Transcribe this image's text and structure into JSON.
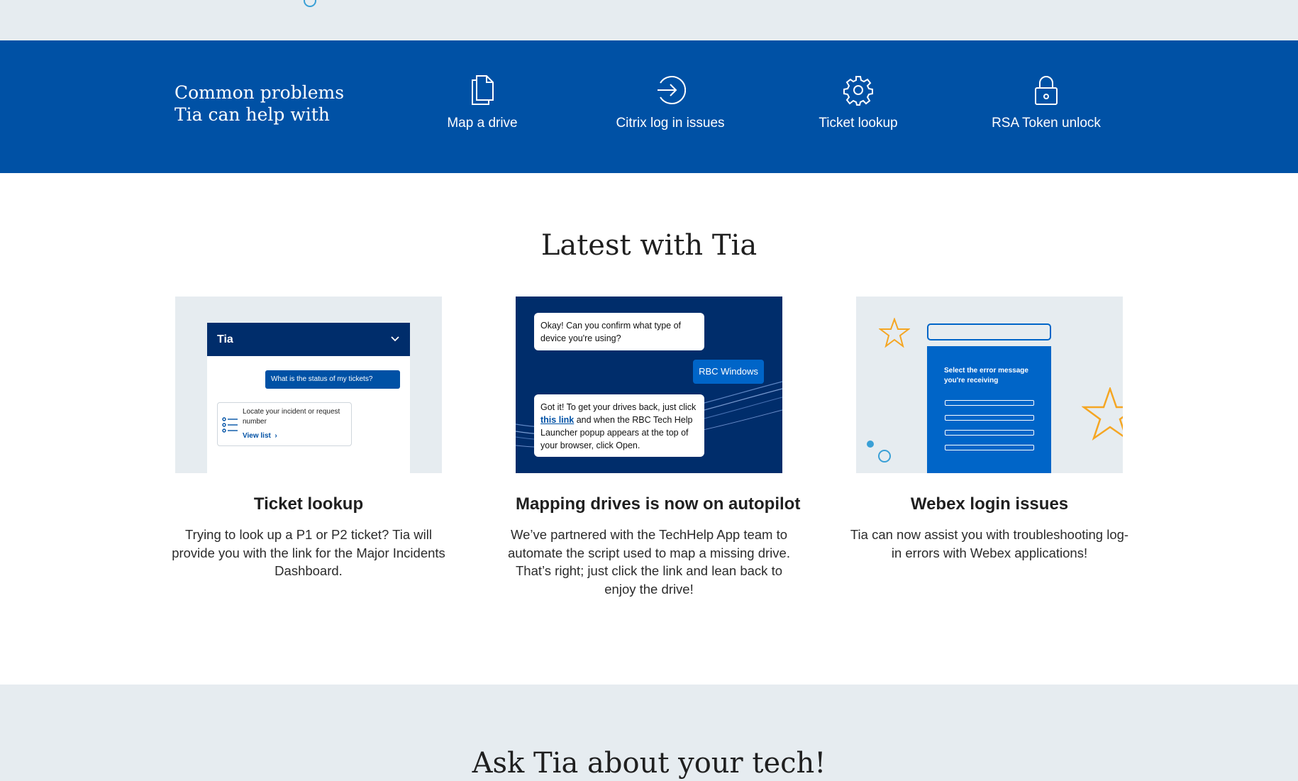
{
  "band": {
    "title_line1": "Common problems",
    "title_line2": "Tia can help with",
    "items": [
      {
        "label": "Map a drive",
        "icon": "document-icon"
      },
      {
        "label": "Citrix log in issues",
        "icon": "login-arrow-icon"
      },
      {
        "label": "Ticket lookup",
        "icon": "gear-icon"
      },
      {
        "label": "RSA Token unlock",
        "icon": "lock-icon"
      }
    ]
  },
  "latest": {
    "title": "Latest with Tia",
    "cards": [
      {
        "heading": "Ticket lookup",
        "body": "Trying to look up a P1 or P2 ticket? Tia will provide you with the link for the Major Incidents Dashboard.",
        "thumb": {
          "header": "Tia",
          "bubble": "What is the status of my tickets?",
          "card_text": "Locate your incident or request number",
          "card_link": "View list"
        }
      },
      {
        "heading": "Mapping drives is now on autopilot",
        "body": "We’ve partnered with the TechHelp App team to automate the script used to map a missing drive. That’s right; just click the link and lean back to enjoy the drive!",
        "thumb": {
          "msg1": "Okay! Can you confirm what type of device you're using?",
          "reply": "RBC Windows",
          "msg3_a": "Got it! To get your drives back, just click ",
          "msg3_link": "this link",
          "msg3_b": " and when the RBC Tech Help Launcher popup appears at the top of your browser, click Open."
        }
      },
      {
        "heading": "Webex login issues",
        "body": "Tia can now assist you with troubleshooting log-in errors with Webex applications!",
        "thumb": {
          "panel_text": "Select the error message you're receiving"
        }
      }
    ]
  },
  "ask": {
    "title": "Ask Tia about your tech!"
  },
  "colors": {
    "brand_blue": "#0051a5",
    "navy": "#002d6b",
    "light_bg": "#e6ecf0",
    "star_orange": "#f5a623"
  }
}
